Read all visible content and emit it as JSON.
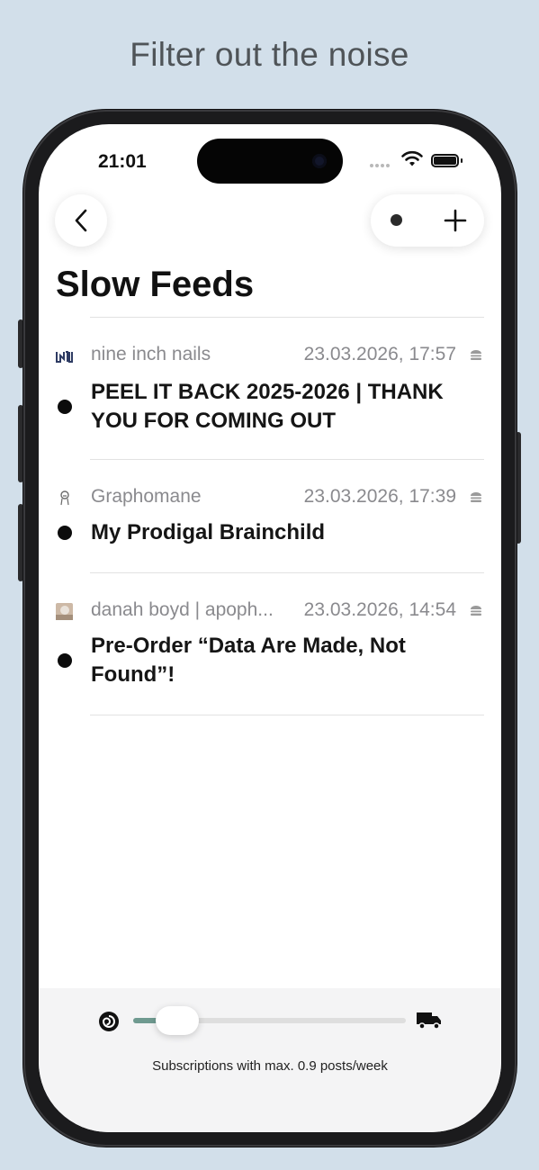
{
  "caption": "Filter out the noise",
  "status_bar": {
    "time": "21:01"
  },
  "page": {
    "title": "Slow Feeds"
  },
  "feed_items": [
    {
      "source": "nine inch nails",
      "date": "23.03.2026, 17:57",
      "title": "PEEL IT BACK 2025-2026 | THANK YOU FOR COMING OUT",
      "icon": "nin-logo-icon",
      "unread": true
    },
    {
      "source": "Graphomane",
      "date": "23.03.2026, 17:39",
      "title": "My Prodigal Brainchild",
      "icon": "graphomane-avatar-icon",
      "unread": true
    },
    {
      "source": "danah boyd | apoph...",
      "date": "23.03.2026, 14:54",
      "title": "Pre-Order “Data Are Made, Not Found”!",
      "icon": "danah-boyd-avatar-icon",
      "unread": true
    }
  ],
  "filter": {
    "caption": "Subscriptions with max. 0.9 posts/week",
    "slider_fraction": 0.12,
    "min_icon": "snail-icon",
    "max_icon": "truck-icon"
  },
  "colors": {
    "background": "#d2dfea",
    "slider_accent": "#6f9a90",
    "text_primary": "#151515",
    "text_secondary": "#8a8a8e"
  }
}
